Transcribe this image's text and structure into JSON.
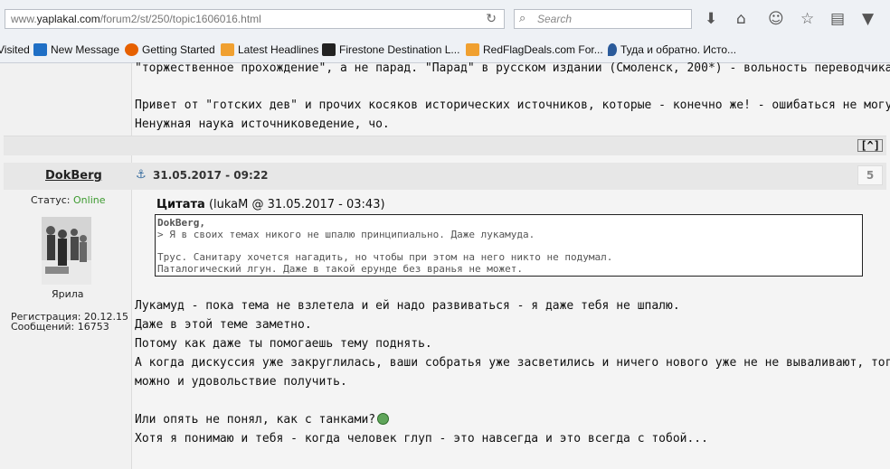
{
  "browser": {
    "url_prefix": "www.",
    "url_domain": "yaplakal.com",
    "url_path": "/forum2/st/250/topic1606016.html",
    "search_placeholder": "Search",
    "icons": [
      "reload-icon",
      "search-icon",
      "download-icon",
      "home-icon",
      "smiley-icon",
      "star-icon",
      "reader-icon",
      "pocket-icon"
    ]
  },
  "bookmarks": [
    "Visited",
    "New Message",
    "Getting Started",
    "Latest Headlines",
    "Firestone Destination L...",
    "RedFlagDeals.com For...",
    "Туда и обратно. Исто..."
  ],
  "prev_post": {
    "lines": [
      "\"торжественное прохождение\", а не парад. \"Парад\" в русском издании (Смоленск, 200*) - вольность переводчика.",
      "",
      "Привет от \"готских дев\" и прочих косяков исторических источников, которые - конечно же! - ошибаться не могут, да.",
      "Ненужная наука источниковедение, чо."
    ],
    "up_label": "[^]"
  },
  "post": {
    "author": "DokBerg",
    "datetime": "31.05.2017 - 09:22",
    "number": "5",
    "status_label": "Статус:",
    "status_value": "Online",
    "user_title": "Ярила",
    "reg_label": "Регистрация:",
    "reg_value": "20.12.15",
    "msgs_label": "Сообщений:",
    "msgs_value": "16753",
    "quote_label": "Цитата",
    "quote_meta": "(lukaM @ 31.05.2017 - 03:43)",
    "quote_lines": [
      "DokBerg,",
      "> Я в своих темах никого не шпалю принципиально. Даже лукамуда.",
      "",
      "Трус. Санитару хочется нагадить, но чтобы при этом на него никто не подумал.",
      "Паталогический лгун. Даже в такой ерунде без вранья не может."
    ],
    "body_lines": [
      "Лукамуд - пока тема не взлетела и ей надо развиваться - я даже тебя не шпалю.",
      "Даже в этой теме заметно.",
      "Потому как даже ты помогаешь тему поднять.",
      "А когда дискуссия уже закруглилась, ваши собратья уже засветились и ничего нового уже не не вываливают, тогда",
      "можно и удовольствие получить.",
      "",
      "Или опять не понял, как с танками?",
      "Хотя я понимаю и тебя - когда человек глуп - это навсегда и это всегда с тобой..."
    ]
  }
}
